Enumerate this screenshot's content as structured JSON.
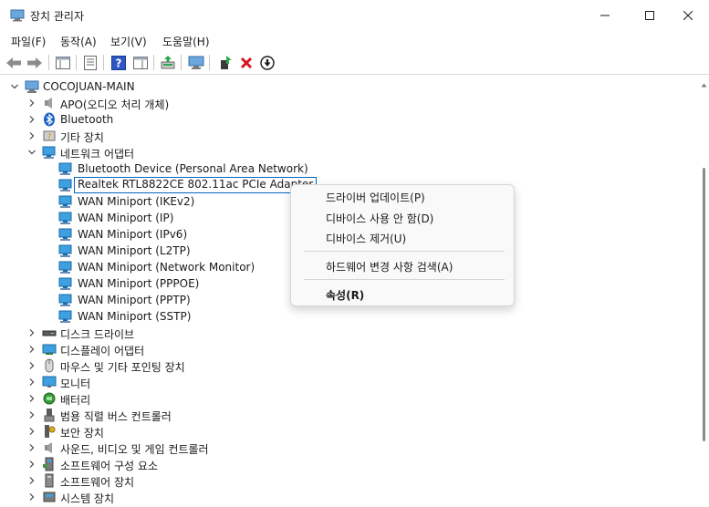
{
  "window": {
    "title": "장치 관리자"
  },
  "menu": [
    "파일(F)",
    "동작(A)",
    "보기(V)",
    "도움말(H)"
  ],
  "toolbar": {
    "icons": [
      "back-arrow-icon",
      "forward-arrow-icon",
      "show-hide-tree-icon",
      "properties-icon",
      "help-icon",
      "action-pane-icon",
      "update-driver-icon",
      "scan-hardware-icon",
      "enable-device-icon",
      "uninstall-icon",
      "disable-device-icon"
    ]
  },
  "tree": {
    "root": "COCOJUAN-MAIN",
    "items": [
      {
        "label": "APO(오디오 처리 개체)",
        "icon": "speaker-icon",
        "expanded": false
      },
      {
        "label": "Bluetooth",
        "icon": "bluetooth-icon",
        "expanded": false
      },
      {
        "label": "기타 장치",
        "icon": "unknown-device-icon",
        "expanded": false
      },
      {
        "label": "네트워크 어댑터",
        "icon": "network-adapter-icon",
        "expanded": true
      },
      {
        "label": "디스크 드라이브",
        "icon": "disk-drive-icon",
        "expanded": false
      },
      {
        "label": "디스플레이 어댑터",
        "icon": "display-adapter-icon",
        "expanded": false
      },
      {
        "label": "마우스 및 기타 포인팅 장치",
        "icon": "mouse-icon",
        "expanded": false
      },
      {
        "label": "모니터",
        "icon": "monitor-icon",
        "expanded": false
      },
      {
        "label": "배터리",
        "icon": "battery-icon",
        "expanded": false
      },
      {
        "label": "범용 직렬 버스 컨트롤러",
        "icon": "usb-icon",
        "expanded": false
      },
      {
        "label": "보안 장치",
        "icon": "security-key-icon",
        "expanded": false
      },
      {
        "label": "사운드, 비디오 및 게임 컨트롤러",
        "icon": "speaker-icon",
        "expanded": false
      },
      {
        "label": "소프트웨어 구성 요소",
        "icon": "software-component-icon",
        "expanded": false
      },
      {
        "label": "소프트웨어 장치",
        "icon": "software-device-icon",
        "expanded": false
      },
      {
        "label": "시스템 장치",
        "icon": "system-device-icon",
        "expanded": false
      }
    ],
    "network_children": [
      "Bluetooth Device (Personal Area Network)",
      "Realtek RTL8822CE 802.11ac PCIe Adapter",
      "WAN Miniport (IKEv2)",
      "WAN Miniport (IP)",
      "WAN Miniport (IPv6)",
      "WAN Miniport (L2TP)",
      "WAN Miniport (Network Monitor)",
      "WAN Miniport (PPPOE)",
      "WAN Miniport (PPTP)",
      "WAN Miniport (SSTP)"
    ],
    "selected": "Realtek RTL8822CE 802.11ac PCIe Adapter"
  },
  "context_menu": {
    "items": [
      "드라이버 업데이트(P)",
      "디바이스 사용 안 함(D)",
      "디바이스 제거(U)",
      "하드웨어 변경 사항 검색(A)",
      "속성(R)"
    ]
  },
  "colors": {
    "selection_border": "#0067c0",
    "network_icon": "#1f8ad6",
    "uninstall_red": "#d8141f"
  }
}
